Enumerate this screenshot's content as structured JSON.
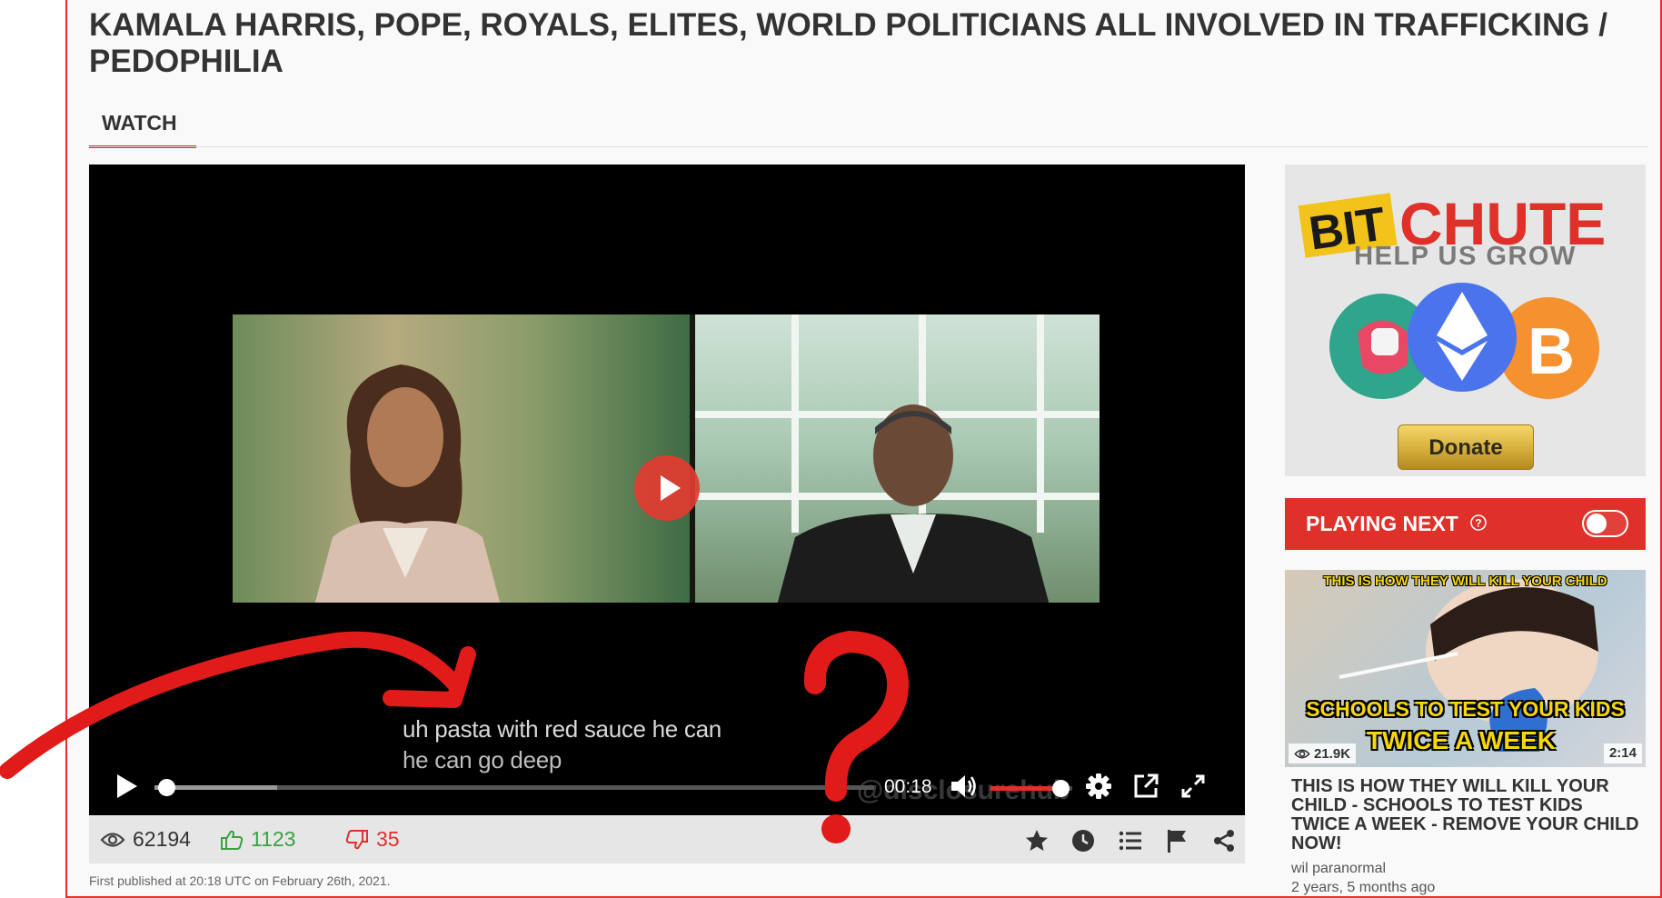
{
  "video": {
    "title": "KAMALA HARRIS, POPE, ROYALS, ELITES, WORLD POLITICIANS ALL INVOLVED IN TRAFFICKING / PEDOPHILIA",
    "tab_watch": "WATCH",
    "captions": [
      "uh pasta with red sauce he can",
      "he can go deep"
    ],
    "watermark": "@disclosurehub",
    "time": "00:18",
    "progress_fraction": 0.017,
    "buffered_fraction": 0.17,
    "volume_fraction": 0.86
  },
  "stats": {
    "views": "62194",
    "likes": "1123",
    "dislikes": "35",
    "published": "First published at 20:18 UTC on February 26th, 2021."
  },
  "sidebar": {
    "logo_part1": "BIT",
    "logo_part2": "CHUTE",
    "help_grow": "HELP US GROW",
    "donate": "Donate",
    "playing_next": "PLAYING NEXT",
    "next_video": {
      "thumb_banner": "THIS IS HOW THEY WILL KILL YOUR CHILD",
      "thumb_line1": "SCHOOLS TO TEST YOUR KIDS",
      "thumb_line2": "TWICE A WEEK",
      "views": "21.9K",
      "duration": "2:14",
      "title": "THIS IS HOW THEY WILL KILL YOUR CHILD - SCHOOLS TO TEST KIDS TWICE A WEEK - REMOVE YOUR CHILD NOW!",
      "channel": "wil paranormal",
      "age": "2 years, 5 months ago"
    }
  },
  "colors": {
    "accent": "#e0302a",
    "like": "#3ba042",
    "gold": "#d9b23e"
  },
  "icons": [
    "eye-icon",
    "thumbs-up-icon",
    "thumbs-down-icon",
    "star-icon",
    "clock-icon",
    "list-icon",
    "flag-icon",
    "share-icon",
    "play-icon",
    "volume-icon",
    "gear-icon",
    "popout-icon",
    "fullscreen-icon",
    "help-icon"
  ]
}
